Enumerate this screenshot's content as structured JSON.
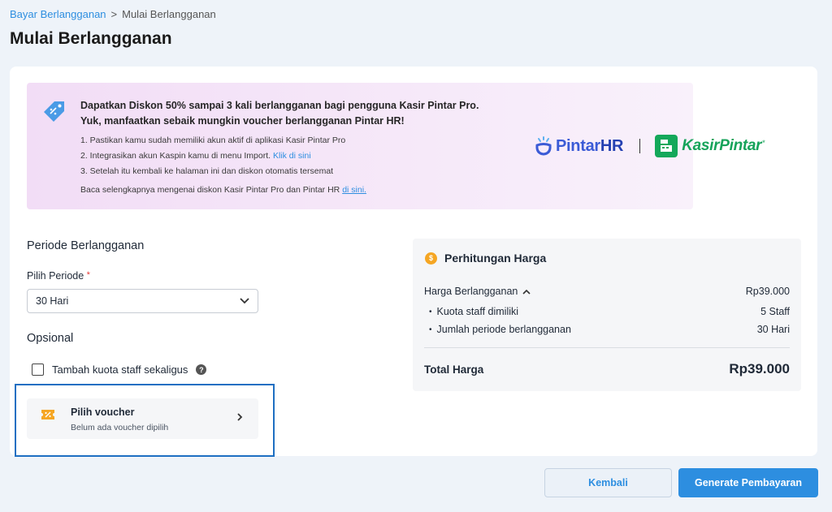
{
  "breadcrumb": {
    "parent": "Bayar Berlangganan",
    "separator": ">",
    "current": "Mulai Berlangganan"
  },
  "page_title": "Mulai Berlangganan",
  "promo": {
    "headline_1": "Dapatkan Diskon 50% sampai 3 kali berlangganan bagi pengguna Kasir Pintar Pro.",
    "headline_2": "Yuk, manfaatkan sebaik mungkin voucher berlangganan Pintar HR!",
    "steps": [
      {
        "text": "1. Pastikan kamu sudah memiliki akun aktif di aplikasi Kasir Pintar Pro"
      },
      {
        "text": "2. Integrasikan akun Kaspin kamu di menu Import.",
        "link": "Klik di sini"
      },
      {
        "text": "3. Setelah itu kembali ke halaman ini dan diskon otomatis tersemat"
      }
    ],
    "footer_text": "Baca selengkapnya mengenai diskon Kasir Pintar Pro dan Pintar HR",
    "footer_link": "di sini.",
    "logo_pintarhr": {
      "main": "Pintar",
      "hr": "HR"
    },
    "logo_kasirpintar": "KasirPintar",
    "logo_kasirpintar_mark": "*",
    "icon": "discount-tag-icon"
  },
  "periode": {
    "section_title": "Periode Berlangganan",
    "label": "Pilih Periode",
    "required_mark": "*",
    "selected": "30 Hari"
  },
  "opsional": {
    "section_title": "Opsional",
    "checkbox_label": "Tambah kuota staff sekaligus",
    "checked": false
  },
  "voucher": {
    "title": "Pilih voucher",
    "subtitle": "Belum ada voucher dipilih"
  },
  "summary": {
    "title": "Perhitungan Harga",
    "coin_symbol": "$",
    "subscription_label": "Harga Berlangganan",
    "subscription_value": "Rp39.000",
    "items": [
      {
        "label": "Kuota staff dimiliki",
        "value": "5 Staff"
      },
      {
        "label": "Jumlah periode berlangganan",
        "value": "30 Hari"
      }
    ],
    "total_label": "Total Harga",
    "total_value": "Rp39.000"
  },
  "buttons": {
    "back": "Kembali",
    "generate": "Generate Pembayaran"
  },
  "colors": {
    "primary": "#2d8ee0",
    "voucher_frame": "#1e6fc2",
    "promo_bg": "#f2ddf6",
    "kasirpintar_green": "#14a85a"
  }
}
